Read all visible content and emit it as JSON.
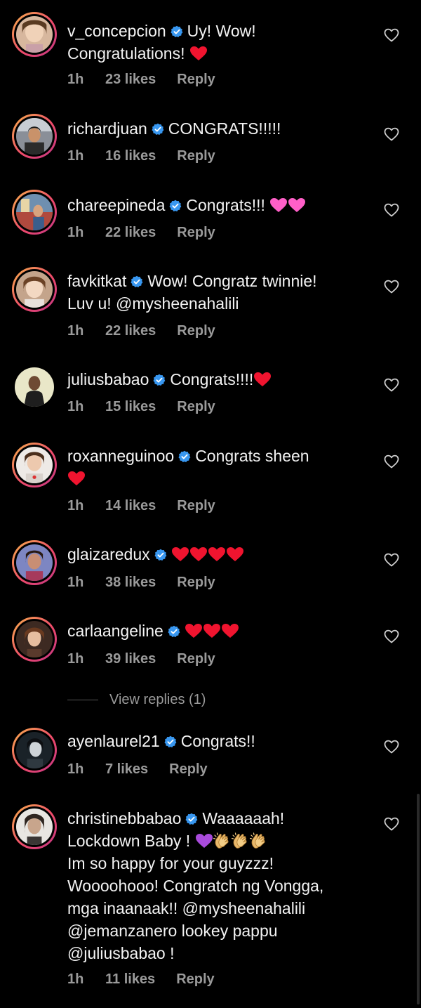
{
  "comments": [
    {
      "username": "v_concepcion",
      "text_lines": [
        "Uy! Wow!",
        "Congratulations!"
      ],
      "emojis": [
        "red-heart"
      ],
      "time": "1h",
      "likes": "23 likes",
      "reply": "Reply",
      "story_ring": true
    },
    {
      "username": "richardjuan",
      "text_lines": [
        "CONGRATS!!!!!"
      ],
      "emojis": [],
      "time": "1h",
      "likes": "16 likes",
      "reply": "Reply",
      "story_ring": true
    },
    {
      "username": "chareepineda",
      "text_lines": [
        "Congrats!!!"
      ],
      "emojis": [
        "pink-heart",
        "pink-heart"
      ],
      "time": "1h",
      "likes": "22 likes",
      "reply": "Reply",
      "story_ring": true
    },
    {
      "username": "favkitkat",
      "text_lines": [
        "Wow! Congratz twinnie!",
        "Luv u! @mysheenahalili"
      ],
      "emojis": [],
      "time": "1h",
      "likes": "22 likes",
      "reply": "Reply",
      "story_ring": true
    },
    {
      "username": "juliusbabao",
      "text_lines": [
        "Congrats!!!!"
      ],
      "emojis": [
        "red-heart"
      ],
      "time": "1h",
      "likes": "15 likes",
      "reply": "Reply",
      "story_ring": false
    },
    {
      "username": "roxanneguinoo",
      "text_lines": [
        "Congrats sheen"
      ],
      "emojis": [
        "red-heart"
      ],
      "time": "1h",
      "likes": "14 likes",
      "reply": "Reply",
      "story_ring": true
    },
    {
      "username": "glaizaredux",
      "text_lines": [
        ""
      ],
      "emojis": [
        "red-heart",
        "red-heart",
        "red-heart",
        "red-heart"
      ],
      "time": "1h",
      "likes": "38 likes",
      "reply": "Reply",
      "story_ring": true
    },
    {
      "username": "carlaangeline",
      "text_lines": [
        ""
      ],
      "emojis": [
        "red-heart",
        "red-heart",
        "red-heart"
      ],
      "time": "1h",
      "likes": "39 likes",
      "reply": "Reply",
      "story_ring": true
    },
    {
      "username": "ayenlaurel21",
      "text_lines": [
        "Congrats!!"
      ],
      "emojis": [],
      "time": "1h",
      "likes": "7 likes",
      "reply": "Reply",
      "story_ring": true
    },
    {
      "username": "christinebbabao",
      "text_lines": [
        "Waaaaaah!",
        "Lockdown Baby !",
        "Im so happy for your guyzzz!",
        "Woooohooo! Congratch ng Vongga,",
        "mga inaanaak!! @mysheenahalili",
        "@jemanzanero lookey pappu",
        "@juliusbabao !"
      ],
      "emojis": [
        "purple-heart",
        "clapping-hands",
        "clapping-hands",
        "clapping-hands"
      ],
      "time": "1h",
      "likes": "11 likes",
      "reply": "Reply",
      "story_ring": true
    }
  ],
  "view_replies": "View replies (1)",
  "colors": {
    "background": "#000000",
    "text": "#f2f2f2",
    "meta": "#9a9a9a",
    "verified": "#3897f0",
    "red_heart": "#f0142f",
    "pink_heart": "#ff5fc8",
    "purple_heart": "#a94bdc"
  }
}
